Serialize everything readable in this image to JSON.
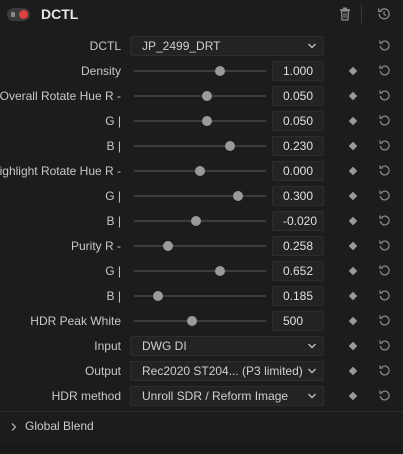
{
  "header": {
    "title": "DCTL",
    "icons": [
      "toggle-switch",
      "trash-icon",
      "reset-history-icon"
    ]
  },
  "colors": {
    "background": "#1c1c1e",
    "field": "#232325",
    "toggle_dot": "#e0413a",
    "text": "#c8c8c8"
  },
  "rows": {
    "dctl": {
      "label": "DCTL",
      "value": "JP_2499_DRT"
    },
    "density": {
      "label": "Density",
      "value": "1.000",
      "level": 0.65
    },
    "ohue_r": {
      "label": "Overall Rotate Hue R -",
      "value": "0.050",
      "level": 0.55
    },
    "ohue_g": {
      "label": "G |",
      "value": "0.050",
      "level": 0.55
    },
    "ohue_b": {
      "label": "B |",
      "value": "0.230",
      "level": 0.73
    },
    "hhue_r": {
      "label": "Highlight Rotate Hue R -",
      "value": "0.000",
      "level": 0.5
    },
    "hhue_g": {
      "label": "G |",
      "value": "0.300",
      "level": 0.79
    },
    "hhue_b": {
      "label": "B |",
      "value": "-0.020",
      "level": 0.47
    },
    "purity_r": {
      "label": "Purity R -",
      "value": "0.258",
      "level": 0.26
    },
    "purity_g": {
      "label": "G |",
      "value": "0.652",
      "level": 0.65
    },
    "purity_b": {
      "label": "B |",
      "value": "0.185",
      "level": 0.18
    },
    "peak": {
      "label": "HDR Peak White",
      "value": "500",
      "level": 0.44
    },
    "input": {
      "label": "Input",
      "value": "DWG DI"
    },
    "output": {
      "label": "Output",
      "value": "Rec2020 ST204... (P3 limited)"
    },
    "hdr_method": {
      "label": "HDR method",
      "value": "Unroll SDR / Reform Image"
    }
  },
  "footer": {
    "label": "Global Blend"
  }
}
